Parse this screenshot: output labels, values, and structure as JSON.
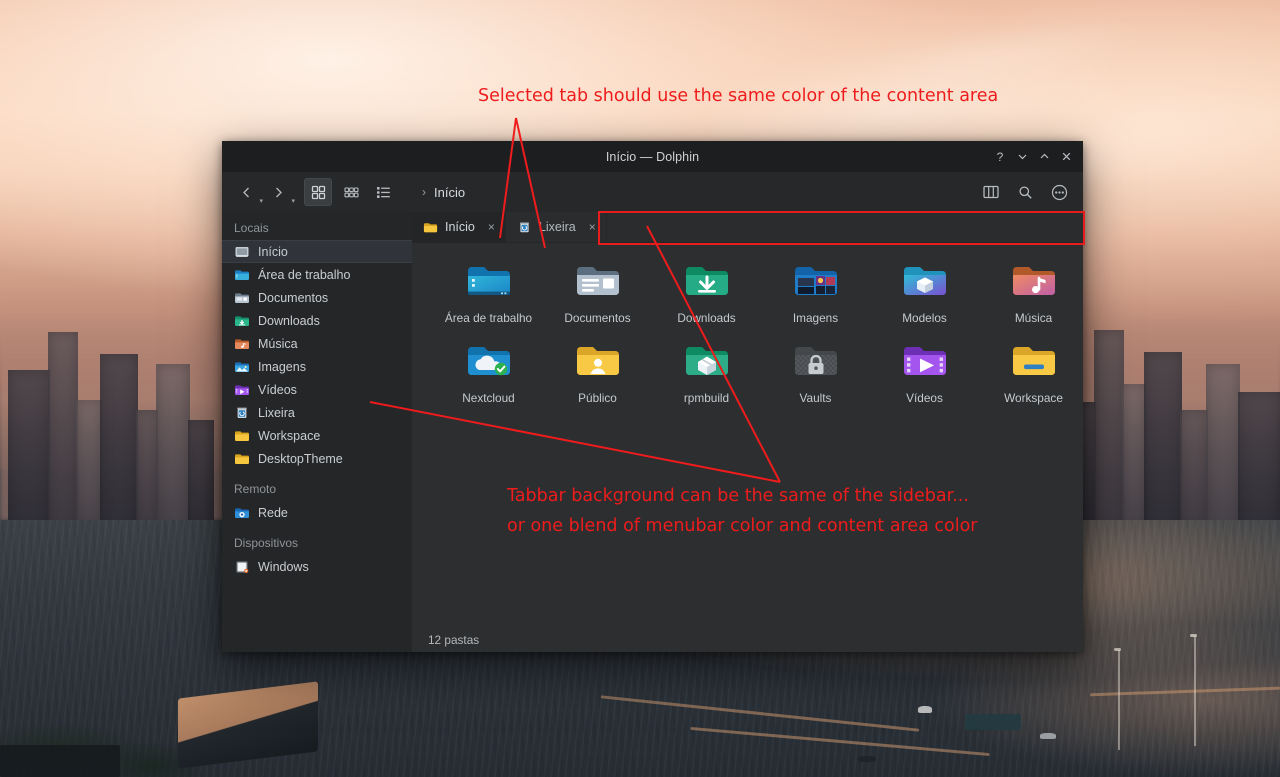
{
  "window": {
    "title": "Início — Dolphin",
    "titlebar_buttons": [
      {
        "name": "help-button",
        "glyph": "?"
      },
      {
        "name": "minimize-button",
        "glyph": "chevron-down"
      },
      {
        "name": "maximize-button",
        "glyph": "chevron-up"
      },
      {
        "name": "close-button",
        "glyph": "close"
      }
    ]
  },
  "toolbar": {
    "back_label": "Voltar",
    "forward_label": "Avançar",
    "views": [
      {
        "name": "view-icons",
        "label": "Ícones",
        "active": true
      },
      {
        "name": "view-compact",
        "label": "Compacto",
        "active": false
      },
      {
        "name": "view-details",
        "label": "Detalhes",
        "active": false
      }
    ],
    "breadcrumb": [
      "Início"
    ],
    "right": [
      {
        "name": "split-view-button",
        "label": "Dividir"
      },
      {
        "name": "search-button",
        "label": "Procurar"
      },
      {
        "name": "menu-button",
        "label": "Menu"
      }
    ]
  },
  "sidebar": {
    "groups": [
      {
        "title": "Locais",
        "items": [
          {
            "label": "Início",
            "icon": "home-folder-icon",
            "selected": true
          },
          {
            "label": "Área de trabalho",
            "icon": "desktop-folder-icon",
            "selected": false
          },
          {
            "label": "Documentos",
            "icon": "documents-folder-icon",
            "selected": false
          },
          {
            "label": "Downloads",
            "icon": "downloads-folder-icon",
            "selected": false
          },
          {
            "label": "Música",
            "icon": "music-folder-icon",
            "selected": false
          },
          {
            "label": "Imagens",
            "icon": "pictures-folder-icon",
            "selected": false
          },
          {
            "label": "Vídeos",
            "icon": "videos-folder-icon",
            "selected": false
          },
          {
            "label": "Lixeira",
            "icon": "trash-icon",
            "selected": false
          },
          {
            "label": "Workspace",
            "icon": "folder-icon",
            "selected": false
          },
          {
            "label": "DesktopTheme",
            "icon": "folder-icon",
            "selected": false
          }
        ]
      },
      {
        "title": "Remoto",
        "items": [
          {
            "label": "Rede",
            "icon": "network-icon",
            "selected": false
          }
        ]
      },
      {
        "title": "Dispositivos",
        "items": [
          {
            "label": "Windows",
            "icon": "windows-drive-icon",
            "selected": false
          }
        ]
      }
    ]
  },
  "tabs": [
    {
      "label": "Início",
      "icon": "folder-icon",
      "selected": true,
      "close": "×"
    },
    {
      "label": "Lixeira",
      "icon": "trash-icon",
      "selected": false,
      "close": "×"
    }
  ],
  "files": [
    {
      "label": "Área de trabalho",
      "icon": "desktop-folder-icon"
    },
    {
      "label": "Documentos",
      "icon": "documents-folder-icon"
    },
    {
      "label": "Downloads",
      "icon": "downloads-folder-icon"
    },
    {
      "label": "Imagens",
      "icon": "pictures-folder-icon"
    },
    {
      "label": "Modelos",
      "icon": "templates-folder-icon"
    },
    {
      "label": "Música",
      "icon": "music-folder-icon"
    },
    {
      "label": "Nextcloud",
      "icon": "nextcloud-folder-icon"
    },
    {
      "label": "Público",
      "icon": "public-folder-icon"
    },
    {
      "label": "rpmbuild",
      "icon": "rpmbuild-folder-icon"
    },
    {
      "label": "Vaults",
      "icon": "vaults-folder-icon"
    },
    {
      "label": "Vídeos",
      "icon": "videos-folder-icon"
    },
    {
      "label": "Workspace",
      "icon": "workspace-folder-icon"
    }
  ],
  "statusbar": {
    "text": "12 pastas"
  },
  "annotations": {
    "color": "#ee1c1c",
    "top_note": "Selected tab should use the same color of the content area",
    "bottom_note_line1": "Tabbar background can be the same of the sidebar...",
    "bottom_note_line2": "or one blend of menubar color and content area color"
  },
  "colors": {
    "titlebar": "#1d1e20",
    "toolbar": "#26282a",
    "sidebar": "#252628",
    "tabbar": "#2a2c2e",
    "content": "#2c2e30",
    "selected_tab": "#232527",
    "annotation_red": "#ee1c1c"
  }
}
